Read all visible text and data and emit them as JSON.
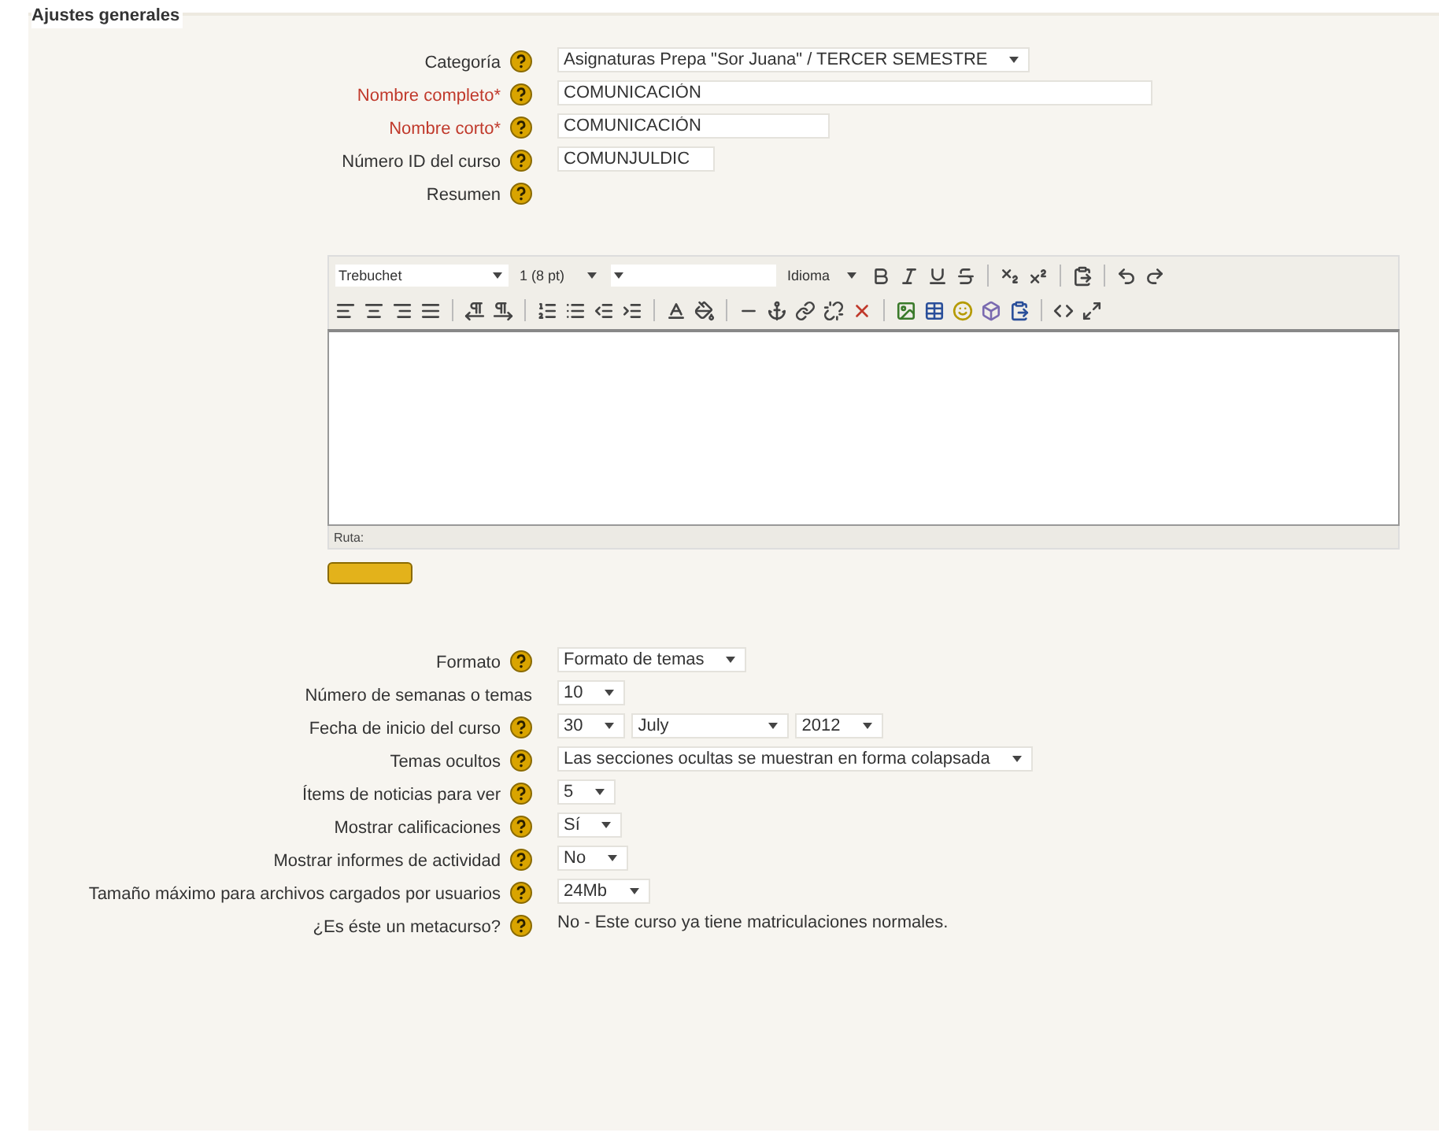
{
  "section": {
    "title": "Ajustes generales"
  },
  "top_rows": [
    {
      "label": "Categoría",
      "required": false,
      "help": true,
      "control": {
        "kind": "select",
        "values": [
          "Asignaturas Prepa \"Sor Juana\" / TERCER SEMESTRE"
        ]
      }
    },
    {
      "label": "Nombre completo*",
      "required": true,
      "help": true,
      "control": {
        "kind": "text",
        "value": "COMUNICACIÓN"
      }
    },
    {
      "label": "Nombre corto*",
      "required": true,
      "help": true,
      "control": {
        "kind": "text",
        "value": "COMUNICACIÓN"
      }
    },
    {
      "label": "Número ID del curso",
      "required": false,
      "help": true,
      "control": {
        "kind": "text",
        "value": "COMUNJULDIC"
      }
    },
    {
      "label": "Resumen",
      "required": false,
      "help": true,
      "control": {
        "kind": "none"
      }
    }
  ],
  "editor": {
    "font": "Trebuchet",
    "size": "1 (8 pt)",
    "language": "Idioma",
    "path_label": "Ruta:"
  },
  "bottom_rows": [
    {
      "label": "Formato",
      "required": false,
      "help": true,
      "control": {
        "kind": "select",
        "values": [
          "Formato de temas"
        ]
      }
    },
    {
      "label": "Número de semanas o temas",
      "required": false,
      "help": false,
      "control": {
        "kind": "select",
        "values": [
          "10"
        ]
      }
    },
    {
      "label": "Fecha de inicio del curso",
      "required": false,
      "help": true,
      "control": {
        "kind": "select",
        "values": [
          "30",
          "July",
          "2012"
        ]
      }
    },
    {
      "label": "Temas ocultos",
      "required": false,
      "help": true,
      "control": {
        "kind": "select",
        "values": [
          "Las secciones ocultas se muestran en forma colapsada"
        ]
      }
    },
    {
      "label": "Ítems de noticias para ver",
      "required": false,
      "help": true,
      "control": {
        "kind": "select",
        "values": [
          "5"
        ]
      }
    },
    {
      "label": "Mostrar calificaciones",
      "required": false,
      "help": true,
      "control": {
        "kind": "select",
        "values": [
          "Sí"
        ]
      }
    },
    {
      "label": "Mostrar informes de actividad",
      "required": false,
      "help": true,
      "control": {
        "kind": "select",
        "values": [
          "No"
        ]
      }
    },
    {
      "label": "Tamaño máximo para archivos cargados por usuarios",
      "required": false,
      "help": true,
      "control": {
        "kind": "select",
        "values": [
          "24Mb"
        ]
      }
    },
    {
      "label": "¿Es éste un metacurso?",
      "required": false,
      "help": true,
      "control": {
        "kind": "static",
        "value": "No - Este curso ya tiene matriculaciones normales."
      }
    }
  ]
}
